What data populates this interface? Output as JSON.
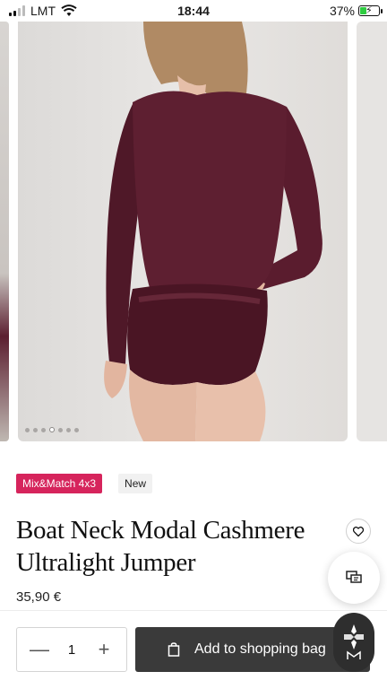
{
  "status_bar": {
    "carrier": "LMT",
    "time": "18:44",
    "battery": "37%"
  },
  "gallery": {
    "image_count": 7,
    "active_index": 3
  },
  "badges": {
    "promo": "Mix&Match 4x3",
    "new": "New"
  },
  "product": {
    "title_line1": "Boat Neck Modal Cashmere",
    "title_line2": "Ultralight Jumper",
    "price": "35,90 €"
  },
  "purchase": {
    "quantity": "1",
    "minus": "—",
    "plus": "+",
    "add_label": "Add to shopping bag"
  },
  "icons": [
    "signal-icon",
    "wifi-icon",
    "battery-icon",
    "heart-icon",
    "chat-icon",
    "bag-icon",
    "brand-logo-icon"
  ],
  "colors": {
    "promo": "#d6245c",
    "button": "#3a3a3a",
    "garment": "#5a1c2e"
  }
}
